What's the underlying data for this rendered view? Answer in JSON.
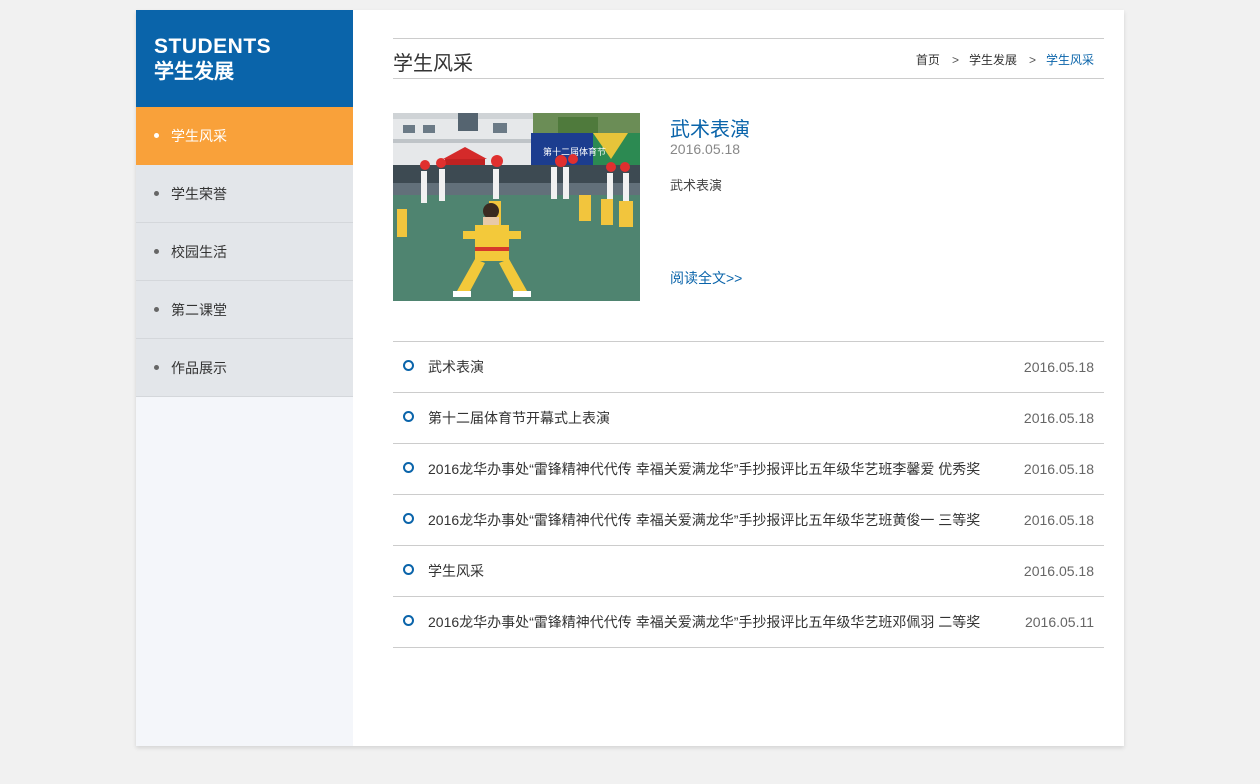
{
  "sidebar": {
    "heading_en": "STUDENTS",
    "heading_cn": "学生发展",
    "items": [
      {
        "label": "学生风采",
        "active": true
      },
      {
        "label": "学生荣誉",
        "active": false
      },
      {
        "label": "校园生活",
        "active": false
      },
      {
        "label": "第二课堂",
        "active": false
      },
      {
        "label": "作品展示",
        "active": false
      }
    ]
  },
  "main": {
    "title": "学生风采",
    "breadcrumb": {
      "items": [
        "首页",
        "学生发展",
        "学生风采"
      ],
      "separator": ">"
    },
    "featured": {
      "title": "武术表演",
      "date": "2016.05.18",
      "summary": "武术表演",
      "read_more": "阅读全文>>",
      "banner_text": "第十二届体育节"
    },
    "news": [
      {
        "title": "武术表演",
        "date": "2016.05.18"
      },
      {
        "title": "第十二届体育节开幕式上表演",
        "date": "2016.05.18"
      },
      {
        "title": "2016龙华办事处“雷锋精神代代传 幸福关爱满龙华”手抄报评比五年级华艺班李馨爱 优秀奖",
        "date": "2016.05.18"
      },
      {
        "title": "2016龙华办事处“雷锋精神代代传 幸福关爱满龙华”手抄报评比五年级华艺班黄俊一 三等奖",
        "date": "2016.05.18"
      },
      {
        "title": "学生风采",
        "date": "2016.05.18"
      },
      {
        "title": "2016龙华办事处“雷锋精神代代传 幸福关爱满龙华”手抄报评比五年级华艺班邓佩羽 二等奖",
        "date": "2016.05.11"
      }
    ]
  },
  "colors": {
    "brand_blue": "#0a64aa",
    "active_orange": "#f9a13a",
    "sidebar_item_bg": "#e3e6ea"
  }
}
